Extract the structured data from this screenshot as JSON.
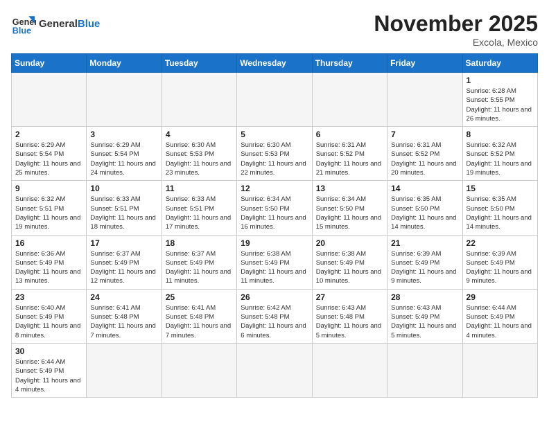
{
  "header": {
    "logo_general": "General",
    "logo_blue": "Blue",
    "month_title": "November 2025",
    "location": "Excola, Mexico"
  },
  "days_of_week": [
    "Sunday",
    "Monday",
    "Tuesday",
    "Wednesday",
    "Thursday",
    "Friday",
    "Saturday"
  ],
  "weeks": [
    [
      {
        "day": "",
        "empty": true
      },
      {
        "day": "",
        "empty": true
      },
      {
        "day": "",
        "empty": true
      },
      {
        "day": "",
        "empty": true
      },
      {
        "day": "",
        "empty": true
      },
      {
        "day": "",
        "empty": true
      },
      {
        "day": "1",
        "sunrise": "Sunrise: 6:28 AM",
        "sunset": "Sunset: 5:55 PM",
        "daylight": "Daylight: 11 hours and 26 minutes."
      }
    ],
    [
      {
        "day": "2",
        "sunrise": "Sunrise: 6:29 AM",
        "sunset": "Sunset: 5:54 PM",
        "daylight": "Daylight: 11 hours and 25 minutes."
      },
      {
        "day": "3",
        "sunrise": "Sunrise: 6:29 AM",
        "sunset": "Sunset: 5:54 PM",
        "daylight": "Daylight: 11 hours and 24 minutes."
      },
      {
        "day": "4",
        "sunrise": "Sunrise: 6:30 AM",
        "sunset": "Sunset: 5:53 PM",
        "daylight": "Daylight: 11 hours and 23 minutes."
      },
      {
        "day": "5",
        "sunrise": "Sunrise: 6:30 AM",
        "sunset": "Sunset: 5:53 PM",
        "daylight": "Daylight: 11 hours and 22 minutes."
      },
      {
        "day": "6",
        "sunrise": "Sunrise: 6:31 AM",
        "sunset": "Sunset: 5:52 PM",
        "daylight": "Daylight: 11 hours and 21 minutes."
      },
      {
        "day": "7",
        "sunrise": "Sunrise: 6:31 AM",
        "sunset": "Sunset: 5:52 PM",
        "daylight": "Daylight: 11 hours and 20 minutes."
      },
      {
        "day": "8",
        "sunrise": "Sunrise: 6:32 AM",
        "sunset": "Sunset: 5:52 PM",
        "daylight": "Daylight: 11 hours and 19 minutes."
      }
    ],
    [
      {
        "day": "9",
        "sunrise": "Sunrise: 6:32 AM",
        "sunset": "Sunset: 5:51 PM",
        "daylight": "Daylight: 11 hours and 19 minutes."
      },
      {
        "day": "10",
        "sunrise": "Sunrise: 6:33 AM",
        "sunset": "Sunset: 5:51 PM",
        "daylight": "Daylight: 11 hours and 18 minutes."
      },
      {
        "day": "11",
        "sunrise": "Sunrise: 6:33 AM",
        "sunset": "Sunset: 5:51 PM",
        "daylight": "Daylight: 11 hours and 17 minutes."
      },
      {
        "day": "12",
        "sunrise": "Sunrise: 6:34 AM",
        "sunset": "Sunset: 5:50 PM",
        "daylight": "Daylight: 11 hours and 16 minutes."
      },
      {
        "day": "13",
        "sunrise": "Sunrise: 6:34 AM",
        "sunset": "Sunset: 5:50 PM",
        "daylight": "Daylight: 11 hours and 15 minutes."
      },
      {
        "day": "14",
        "sunrise": "Sunrise: 6:35 AM",
        "sunset": "Sunset: 5:50 PM",
        "daylight": "Daylight: 11 hours and 14 minutes."
      },
      {
        "day": "15",
        "sunrise": "Sunrise: 6:35 AM",
        "sunset": "Sunset: 5:50 PM",
        "daylight": "Daylight: 11 hours and 14 minutes."
      }
    ],
    [
      {
        "day": "16",
        "sunrise": "Sunrise: 6:36 AM",
        "sunset": "Sunset: 5:49 PM",
        "daylight": "Daylight: 11 hours and 13 minutes."
      },
      {
        "day": "17",
        "sunrise": "Sunrise: 6:37 AM",
        "sunset": "Sunset: 5:49 PM",
        "daylight": "Daylight: 11 hours and 12 minutes."
      },
      {
        "day": "18",
        "sunrise": "Sunrise: 6:37 AM",
        "sunset": "Sunset: 5:49 PM",
        "daylight": "Daylight: 11 hours and 11 minutes."
      },
      {
        "day": "19",
        "sunrise": "Sunrise: 6:38 AM",
        "sunset": "Sunset: 5:49 PM",
        "daylight": "Daylight: 11 hours and 11 minutes."
      },
      {
        "day": "20",
        "sunrise": "Sunrise: 6:38 AM",
        "sunset": "Sunset: 5:49 PM",
        "daylight": "Daylight: 11 hours and 10 minutes."
      },
      {
        "day": "21",
        "sunrise": "Sunrise: 6:39 AM",
        "sunset": "Sunset: 5:49 PM",
        "daylight": "Daylight: 11 hours and 9 minutes."
      },
      {
        "day": "22",
        "sunrise": "Sunrise: 6:39 AM",
        "sunset": "Sunset: 5:49 PM",
        "daylight": "Daylight: 11 hours and 9 minutes."
      }
    ],
    [
      {
        "day": "23",
        "sunrise": "Sunrise: 6:40 AM",
        "sunset": "Sunset: 5:49 PM",
        "daylight": "Daylight: 11 hours and 8 minutes."
      },
      {
        "day": "24",
        "sunrise": "Sunrise: 6:41 AM",
        "sunset": "Sunset: 5:48 PM",
        "daylight": "Daylight: 11 hours and 7 minutes."
      },
      {
        "day": "25",
        "sunrise": "Sunrise: 6:41 AM",
        "sunset": "Sunset: 5:48 PM",
        "daylight": "Daylight: 11 hours and 7 minutes."
      },
      {
        "day": "26",
        "sunrise": "Sunrise: 6:42 AM",
        "sunset": "Sunset: 5:48 PM",
        "daylight": "Daylight: 11 hours and 6 minutes."
      },
      {
        "day": "27",
        "sunrise": "Sunrise: 6:43 AM",
        "sunset": "Sunset: 5:48 PM",
        "daylight": "Daylight: 11 hours and 5 minutes."
      },
      {
        "day": "28",
        "sunrise": "Sunrise: 6:43 AM",
        "sunset": "Sunset: 5:49 PM",
        "daylight": "Daylight: 11 hours and 5 minutes."
      },
      {
        "day": "29",
        "sunrise": "Sunrise: 6:44 AM",
        "sunset": "Sunset: 5:49 PM",
        "daylight": "Daylight: 11 hours and 4 minutes."
      }
    ],
    [
      {
        "day": "30",
        "sunrise": "Sunrise: 6:44 AM",
        "sunset": "Sunset: 5:49 PM",
        "daylight": "Daylight: 11 hours and 4 minutes."
      },
      {
        "day": "",
        "empty": true
      },
      {
        "day": "",
        "empty": true
      },
      {
        "day": "",
        "empty": true
      },
      {
        "day": "",
        "empty": true
      },
      {
        "day": "",
        "empty": true
      },
      {
        "day": "",
        "empty": true
      }
    ]
  ]
}
